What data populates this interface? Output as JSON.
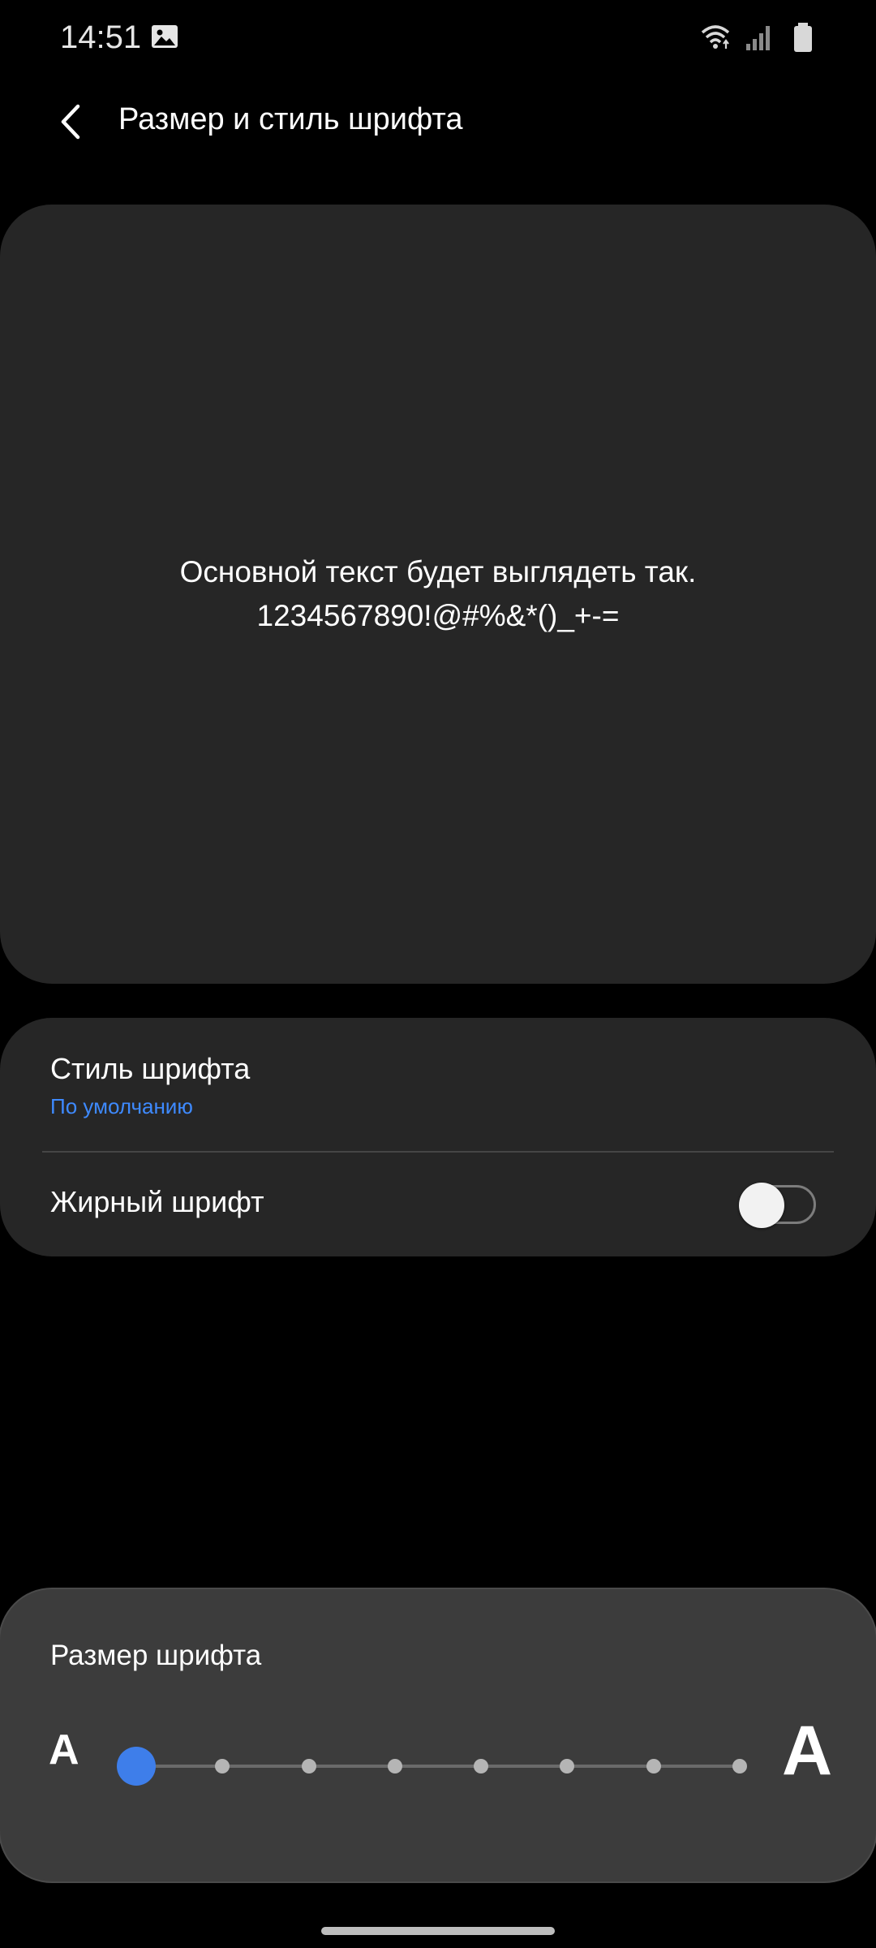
{
  "status_bar": {
    "time": "14:51",
    "icons": [
      "gallery-icon",
      "wifi-icon",
      "signal-icon",
      "battery-icon"
    ]
  },
  "header": {
    "title": "Размер и стиль шрифта",
    "back_icon": "chevron-left-icon"
  },
  "preview": {
    "line1": "Основной текст будет выглядеть так.",
    "line2": "1234567890!@#%&*()_+-="
  },
  "settings": {
    "font_style_label": "Стиль шрифта",
    "font_style_value": "По умолчанию",
    "bold_label": "Жирный шрифт",
    "bold_enabled": false
  },
  "font_size": {
    "title": "Размер шрифта",
    "small_glyph": "A",
    "large_glyph": "A",
    "steps": 8,
    "current_step": 1
  },
  "colors": {
    "accent": "#3e7eea",
    "link": "#3e8aff",
    "card_bg": "#262626",
    "background": "#000000"
  }
}
